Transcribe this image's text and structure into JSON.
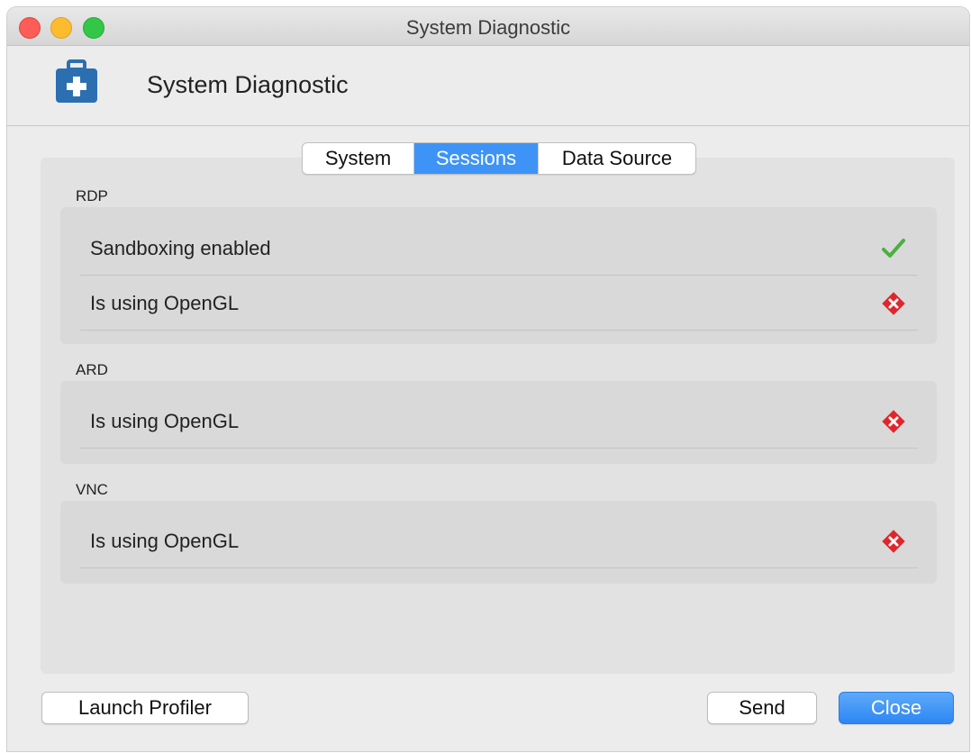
{
  "window": {
    "title": "System Diagnostic"
  },
  "header": {
    "title": "System Diagnostic",
    "icon": "first-aid-kit-icon",
    "icon_color": "#2c6fb0"
  },
  "tabs": [
    {
      "label": "System",
      "active": false
    },
    {
      "label": "Sessions",
      "active": true
    },
    {
      "label": "Data Source",
      "active": false
    }
  ],
  "sections": [
    {
      "label": "RDP",
      "rows": [
        {
          "label": "Sandboxing enabled",
          "status": "pass",
          "icon": "checkmark-icon"
        },
        {
          "label": "Is using OpenGL",
          "status": "fail",
          "icon": "error-icon"
        }
      ]
    },
    {
      "label": "ARD",
      "rows": [
        {
          "label": "Is using OpenGL",
          "status": "fail",
          "icon": "error-icon"
        }
      ]
    },
    {
      "label": "VNC",
      "rows": [
        {
          "label": "Is using OpenGL",
          "status": "fail",
          "icon": "error-icon"
        }
      ]
    }
  ],
  "footer": {
    "launch_profiler_label": "Launch Profiler",
    "send_label": "Send",
    "close_label": "Close"
  },
  "colors": {
    "accent": "#3d94f6",
    "pass": "#4caf3f",
    "fail": "#e0262c"
  }
}
